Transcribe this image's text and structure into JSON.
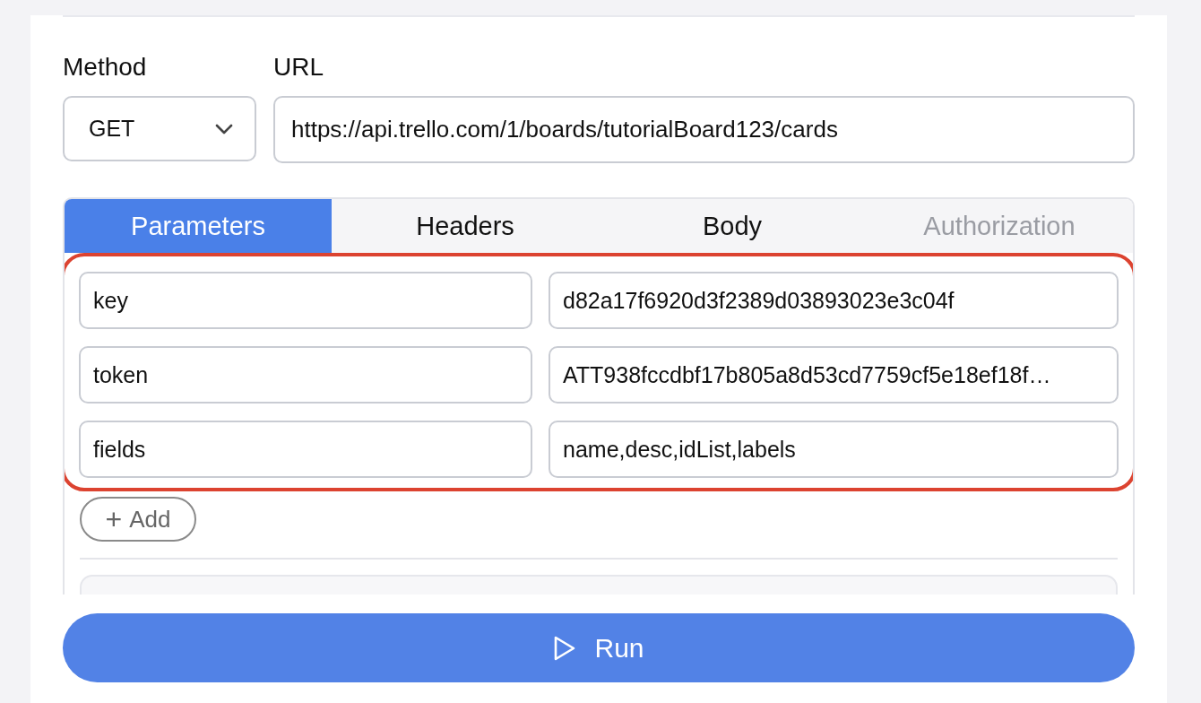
{
  "request": {
    "method_label": "Method",
    "method": "GET",
    "url_label": "URL",
    "url": "https://api.trello.com/1/boards/tutorialBoard123/cards"
  },
  "tabs": [
    {
      "label": "Parameters",
      "selected": true,
      "disabled": false
    },
    {
      "label": "Headers",
      "selected": false,
      "disabled": false
    },
    {
      "label": "Body",
      "selected": false,
      "disabled": false
    },
    {
      "label": "Authorization",
      "selected": false,
      "disabled": true
    }
  ],
  "parameters": [
    {
      "key": "key",
      "value": "d82a17f6920d3f2389d03893023e3c04f"
    },
    {
      "key": "token",
      "value": "ATT938fccdbf17b805a8d53cd7759cf5e18ef18f…"
    },
    {
      "key": "fields",
      "value": "name,desc,idList,labels"
    }
  ],
  "add_button": {
    "icon": "+",
    "label": "Add"
  },
  "run_button": {
    "label": "Run"
  }
}
